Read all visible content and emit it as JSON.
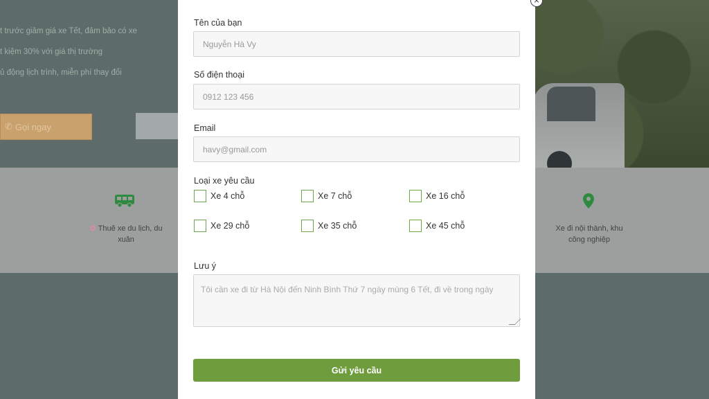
{
  "background": {
    "bullets": [
      "t trước giảm giá xe Tết, đảm bảo có xe",
      "t kiệm 30% với giá thị trường",
      "ủ động lịch trình, miễn phí thay đổi"
    ],
    "call_button": "Gọi ngay",
    "features": [
      {
        "icon": "van-icon",
        "text": "Thuê xe du lịch, du xuân"
      },
      {
        "icon": "map-pin-icon",
        "text": "Xe đi nội thành, khu công nghiệp"
      }
    ]
  },
  "form": {
    "name": {
      "label": "Tên của bạn",
      "placeholder": "Nguyễn Hà Vy"
    },
    "phone": {
      "label": "Số điện thoại",
      "placeholder": "0912 123 456"
    },
    "email": {
      "label": "Email",
      "placeholder": "havy@gmail.com"
    },
    "vehicle": {
      "label": "Loại xe yêu cầu",
      "options": [
        "Xe 4 chỗ",
        "Xe 7 chỗ",
        "Xe 16 chỗ",
        "Xe 29 chỗ",
        "Xe 35 chỗ",
        "Xe 45 chỗ"
      ]
    },
    "note": {
      "label": "Lưu ý",
      "placeholder": "Tôi cần xe đi từ Hà Nội đến Ninh Bình Thứ 7 ngày mùng 6 Tết, đi về trong ngày"
    },
    "submit": "Gửi yêu cầu"
  },
  "colors": {
    "accent": "#6f9c3d",
    "checkbox_border": "#6aa64a",
    "feature_icon": "#2e8a3e"
  }
}
